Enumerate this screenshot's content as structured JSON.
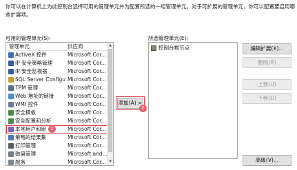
{
  "description": "你可以在计算机上为此控制台选择可用的管理单元并为配置所选的一组管理单元。对于可扩展的管理单元，你可以配置要启用哪些扩展项。",
  "available": {
    "label": "可用的管理单元(S):",
    "columns": [
      "管理单元",
      "供应商"
    ],
    "rows": [
      {
        "name": "ActiveX 控件",
        "vendor": "Microsoft Cor...",
        "icon": "activex-icon",
        "color": "#3b6fb6"
      },
      {
        "name": "IP 安全策略管理",
        "vendor": "Microsoft Cor...",
        "icon": "ip-policy-icon",
        "color": "#2e5f9e"
      },
      {
        "name": "IP 安全监视器",
        "vendor": "Microsoft Cor...",
        "icon": "ip-monitor-icon",
        "color": "#2e5f9e"
      },
      {
        "name": "SQL Server Configura...",
        "vendor": "Microsoft Cor...",
        "icon": "sql-icon",
        "color": "#c7a12c"
      },
      {
        "name": "TPM 管理",
        "vendor": "Microsoft Cor...",
        "icon": "tpm-icon",
        "color": "#5a6f86"
      },
      {
        "name": "Web 地址的链接",
        "vendor": "Microsoft Cor...",
        "icon": "web-link-icon",
        "color": "#4a8fd0"
      },
      {
        "name": "WMI 控件",
        "vendor": "Microsoft Cor...",
        "icon": "wmi-icon",
        "color": "#6a7d92"
      },
      {
        "name": "安全模板",
        "vendor": "Microsoft Cor...",
        "icon": "security-template-icon",
        "color": "#4b8a4b"
      },
      {
        "name": "安全配置和分析",
        "vendor": "Microsoft Cor...",
        "icon": "security-analysis-icon",
        "color": "#4b8a4b"
      },
      {
        "name": "本地用户和组",
        "vendor": "Microsoft Cor...",
        "icon": "users-groups-icon",
        "color": "#7b5fb0"
      },
      {
        "name": "策略的结果集",
        "vendor": "Microsoft Cor...",
        "icon": "rsop-icon",
        "color": "#4a76b8"
      },
      {
        "name": "打印管理",
        "vendor": "Microsoft Cor...",
        "icon": "printer-icon",
        "color": "#555b63"
      },
      {
        "name": "磁盘管理",
        "vendor": "Microsoft and...",
        "icon": "disk-icon",
        "color": "#6f7f8f"
      },
      {
        "name": "服务",
        "vendor": "Microsoft Cor...",
        "icon": "services-icon",
        "color": "#7b8794"
      },
      {
        "name": "高级安全 Windows De...",
        "vendor": "Microsoft Cor...",
        "icon": "firewall-icon",
        "color": "#b54a3a"
      }
    ]
  },
  "add_button": {
    "label": "添加(A) >",
    "badge": "2"
  },
  "row_badge": "1",
  "selected": {
    "label": "所选管理单元(E):",
    "items": [
      {
        "name": "控制台根节点",
        "icon": "folder-icon"
      }
    ]
  },
  "right_buttons": [
    {
      "label": "编辑扩展(X)...",
      "enabled": true
    },
    {
      "label": "删除(R)",
      "enabled": false
    },
    {
      "label": "上移(U)",
      "enabled": false
    },
    {
      "label": "下移(D)",
      "enabled": false
    }
  ],
  "advanced_button": "高级(V)..."
}
